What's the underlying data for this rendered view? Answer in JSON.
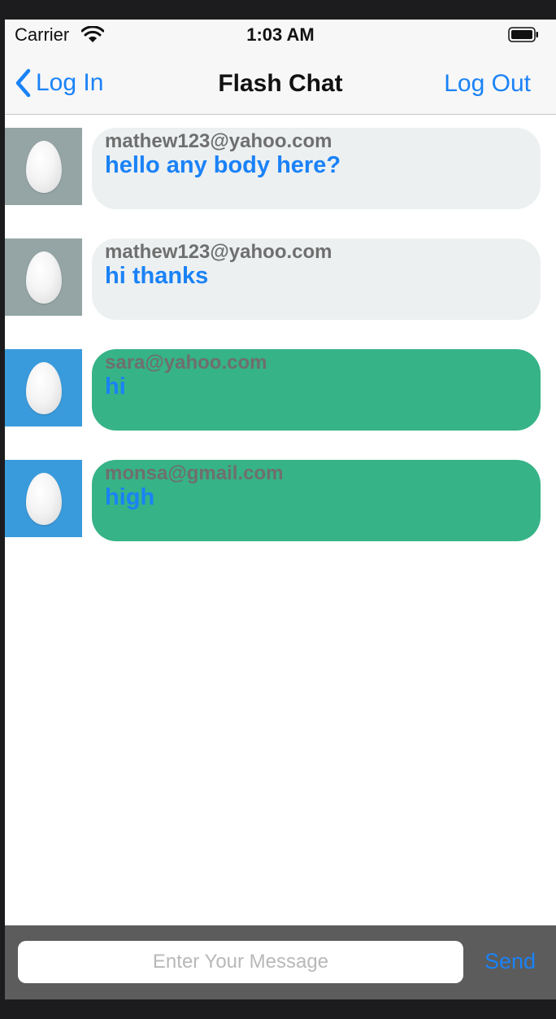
{
  "status_bar": {
    "carrier": "Carrier",
    "time": "1:03 AM"
  },
  "nav": {
    "back_label": "Log In",
    "title": "Flash Chat",
    "logout_label": "Log Out"
  },
  "messages": [
    {
      "sender": "mathew123@yahoo.com",
      "text": "hello any body here?",
      "bubble_color": "#ecf0f1",
      "avatar_color": "#95a5a6"
    },
    {
      "sender": "mathew123@yahoo.com",
      "text": "hi thanks",
      "bubble_color": "#ecf0f1",
      "avatar_color": "#95a5a6"
    },
    {
      "sender": "sara@yahoo.com",
      "text": "hi",
      "bubble_color": "#36b387",
      "avatar_color": "#3a9bdc"
    },
    {
      "sender": "monsa@gmail.com",
      "text": "high",
      "bubble_color": "#36b387",
      "avatar_color": "#3a9bdc"
    }
  ],
  "composer": {
    "placeholder": "Enter Your Message",
    "value": "",
    "send_label": "Send"
  },
  "colors": {
    "accent": "#1a82f7",
    "composer_bg": "#5c5c5c"
  }
}
